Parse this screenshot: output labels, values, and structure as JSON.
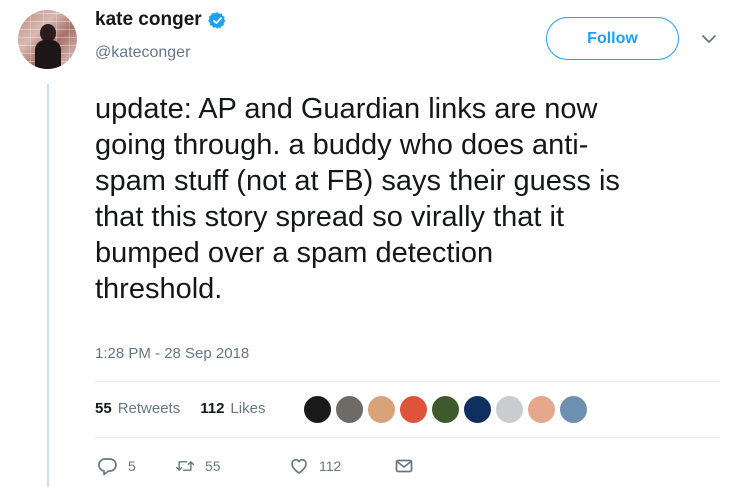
{
  "author": {
    "display_name": "kate conger",
    "handle": "@kateconger",
    "verified_icon": "verified-badge-icon"
  },
  "follow_button": {
    "label": "Follow"
  },
  "tweet": {
    "text": "update: AP and Guardian links are now\ngoing through. a buddy who does anti-\nspam stuff (not at FB) says their guess is\nthat this story spread so virally that it\nbumped over a spam detection\nthreshold.",
    "timestamp": "1:28 PM - 28 Sep 2018"
  },
  "stats": {
    "retweets_count": "55",
    "retweets_label": "Retweets",
    "likes_count": "112",
    "likes_label": "Likes"
  },
  "likers": [
    {
      "color": "#1a1a1a"
    },
    {
      "color": "#6f6a66"
    },
    {
      "color": "#d9a37a"
    },
    {
      "color": "#e0533b"
    },
    {
      "color": "#3e5a2d"
    },
    {
      "color": "#0f2f5f"
    },
    {
      "color": "#c9cdd2"
    },
    {
      "color": "#e6a88d"
    },
    {
      "color": "#6f8fb0"
    }
  ],
  "actions": {
    "reply_count": "5",
    "retweet_count": "55",
    "like_count": "112"
  },
  "colors": {
    "accent": "#1da1f2",
    "secondary_text": "#657786",
    "thread_line": "#c4e3f7"
  }
}
